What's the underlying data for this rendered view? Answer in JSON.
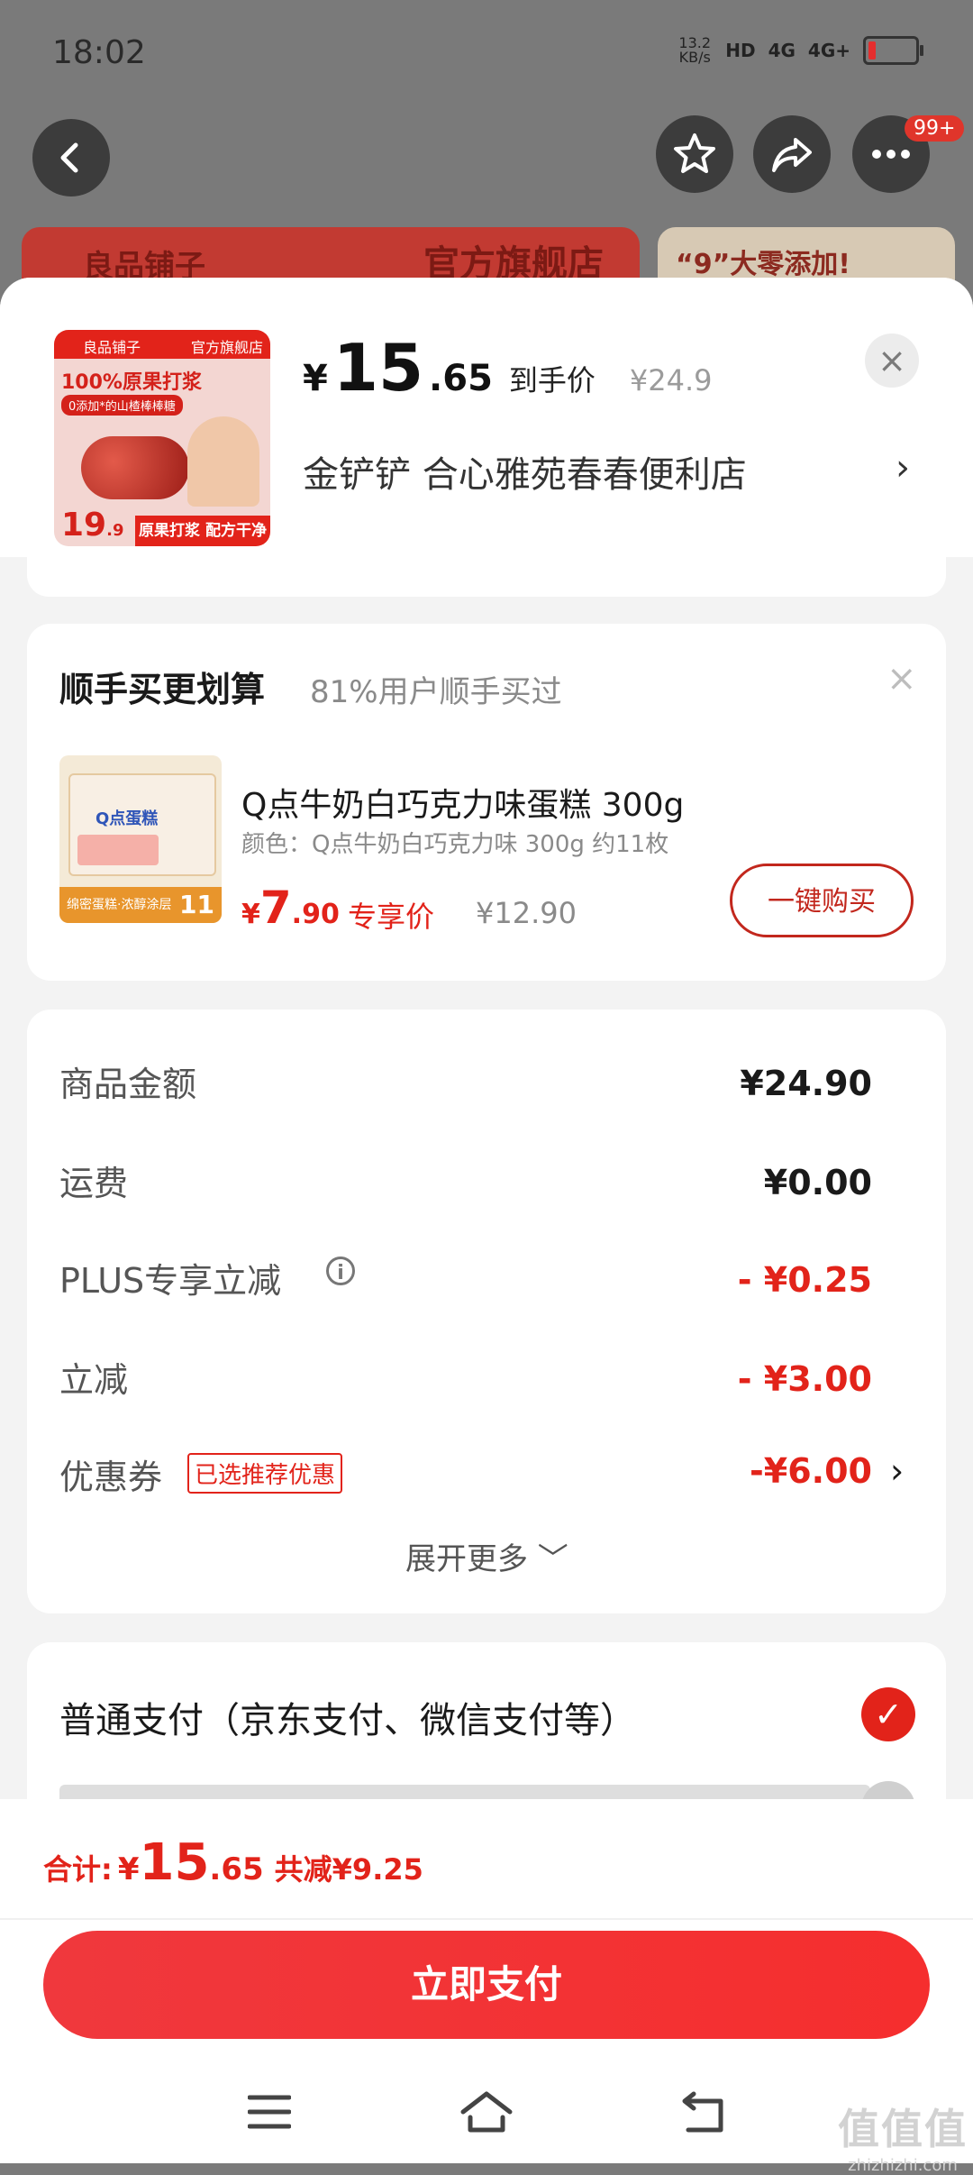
{
  "status_bar": {
    "time": "18:02",
    "net_speed_value": "13.2",
    "net_speed_unit": "KB/s",
    "hd": "HD",
    "net1": "4G",
    "net2": "4G+"
  },
  "top_nav": {
    "more_badge": "99+"
  },
  "background_banner": {
    "store_name": "良品铺子",
    "flagship_label": "官方旗舰店",
    "promo_text": "“9”大零添加!"
  },
  "product": {
    "thumb": {
      "brand": "良品铺子",
      "store_tag": "官方旗舰店",
      "headline": "100%原果打浆",
      "sub": "0添加*的山楂棒棒糖",
      "price_int": "19",
      "price_dec": ".9",
      "strip": "原果打浆 配方干净"
    },
    "price_symbol": "¥",
    "price_int": "15",
    "price_dec": ".65",
    "price_tag": "到手价",
    "original_price": "¥24.9",
    "spec": "金铲铲  合心雅苑春春便利店",
    "spec_arrow": "›",
    "close_label": "×"
  },
  "bundle": {
    "title": "顺手买更划算",
    "subtitle": "81%用户顺手买过",
    "close_label": "×",
    "thumb": {
      "logo": "Q点蛋糕",
      "bottom_text": "绵密蛋糕·浓醇涂层",
      "badge": "11"
    },
    "item_name": "Q点牛奶白巧克力味蛋糕 300g",
    "item_spec": "颜色：Q点牛奶白巧克力味 300g 约11枚",
    "price_symbol": "¥",
    "price_int": "7",
    "price_dec": ".90",
    "price_label": "专享价",
    "original_price": "¥12.90",
    "buy_button": "一键购买"
  },
  "summary": {
    "rows": [
      {
        "label": "商品金额",
        "value": "¥24.90"
      },
      {
        "label": "运费",
        "value": "¥0.00"
      },
      {
        "label": "PLUS专享立减",
        "value": "- ¥0.25"
      },
      {
        "label": "立减",
        "value": "- ¥3.00"
      },
      {
        "label": "优惠券",
        "value": "-¥6.00"
      }
    ],
    "info_icon": "i",
    "coupon_tag": "已选推荐优惠",
    "coupon_arrow": "›",
    "expand_label": "展开更多 ﹀"
  },
  "payment": {
    "option_label": "普通支付（京东支付、微信支付等）",
    "check": "✓"
  },
  "bottom": {
    "total_label": "合计:",
    "total_symbol": "¥",
    "total_int": "15",
    "total_dec": ".65",
    "savings": "共减¥9.25",
    "pay_button": "立即支付"
  },
  "watermark": {
    "text": "值值值",
    "url": "zhizhizhi.com"
  },
  "colors": {
    "accent_red": "#e2231a",
    "dim_background": "#7a7a7a",
    "sheet_background": "#f3f3f3"
  }
}
